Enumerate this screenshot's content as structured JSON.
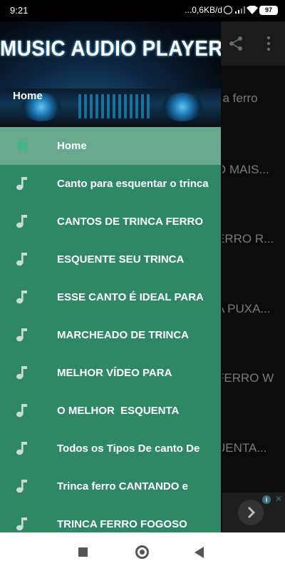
{
  "status_bar": {
    "time": "9:21",
    "network_speed": "...0,6KB/d",
    "battery": "97",
    "icons": [
      "alarm-icon",
      "signal-icon",
      "wifi-icon",
      "battery-icon"
    ]
  },
  "background": {
    "list_fragments": [
      "ca ferro",
      "O MAIS...",
      "ERRO R...",
      "A PUXA...",
      "FERRO W",
      "UENTA..."
    ],
    "appbar_icons": [
      "share-icon",
      "more-vert-icon"
    ]
  },
  "drawer": {
    "header_title": "MUSIC AUDIO PLAYER",
    "header_subtitle": "Home",
    "items": [
      {
        "label": "Home",
        "icon": "home-icon",
        "active": true
      },
      {
        "label": "Canto para esquentar o trinca",
        "icon": "music-note-icon"
      },
      {
        "label": "CANTOS DE TRINCA FERRO",
        "icon": "music-note-icon"
      },
      {
        "label": "ESQUENTE SEU TRINCA",
        "icon": "music-note-icon"
      },
      {
        "label": "ESSE CANTO É IDEAL PARA",
        "icon": "music-note-icon"
      },
      {
        "label": "MARCHEADO DE TRINCA",
        "icon": "music-note-icon"
      },
      {
        "label": "MELHOR VÍDEO PARA",
        "icon": "music-note-icon"
      },
      {
        "label": "O MELHOR  ESQUENTA",
        "icon": "music-note-icon"
      },
      {
        "label": "Todos os Tipos De canto De",
        "icon": "music-note-icon"
      },
      {
        "label": "Trinca ferro CANTANDO e",
        "icon": "music-note-icon"
      },
      {
        "label": "TRINCA FERRO FOGOSO",
        "icon": "music-note-icon"
      }
    ]
  },
  "colors": {
    "drawer_bg": "#2f8768",
    "active_item_bg": "#68a890",
    "active_icon": "#3fb58a",
    "note_icon": "#c8ded5"
  },
  "nav_bar": {
    "buttons": [
      "recent-apps-button",
      "home-button",
      "back-button"
    ]
  }
}
